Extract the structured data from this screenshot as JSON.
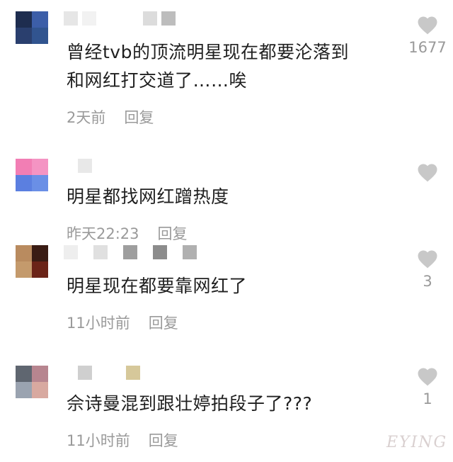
{
  "comments": [
    {
      "avatar_colors": [
        "#1e2d4f",
        "#3c5ea8",
        "#2a3f6e",
        "#31548f"
      ],
      "username_blocks": [
        "#e6e6e6",
        "#f2f2f2",
        "#dcdcdc",
        "#bdbdbd"
      ],
      "text": "曾经tvb的顶流明星现在都要沦落到\n和网红打交道了……唉",
      "time": "2天前",
      "reply": "回复",
      "likes": "1677"
    },
    {
      "avatar_colors": [
        "#f27eb4",
        "#f494c3",
        "#5b7fe0",
        "#6a8fe6"
      ],
      "username_blocks": [
        "#e8e8e8"
      ],
      "text": "明星都找网红蹭热度",
      "time": "昨天22:23",
      "reply": "回复",
      "likes": ""
    },
    {
      "avatar_colors": [
        "#b98b5f",
        "#3a1c14",
        "#c49a6c",
        "#6b2418"
      ],
      "username_blocks": [
        "#eeeeee",
        "#e0e0e0",
        "#9e9e9e",
        "#8c8c8c",
        "#b0b0b0"
      ],
      "text": "明星现在都要靠网红了",
      "time": "11小时前",
      "reply": "回复",
      "likes": "3"
    },
    {
      "avatar_colors": [
        "#5f6670",
        "#b7858f",
        "#9aa3b0",
        "#d8a9a0"
      ],
      "username_blocks": [
        "#cfcfcf",
        "#d6c89a"
      ],
      "text": "佘诗曼混到跟壮婷拍段子了???",
      "time": "11小时前",
      "reply": "回复",
      "likes": "1"
    }
  ],
  "like_icon": "heart-icon",
  "like_color": "#c8c8c8",
  "watermark": "EYING"
}
